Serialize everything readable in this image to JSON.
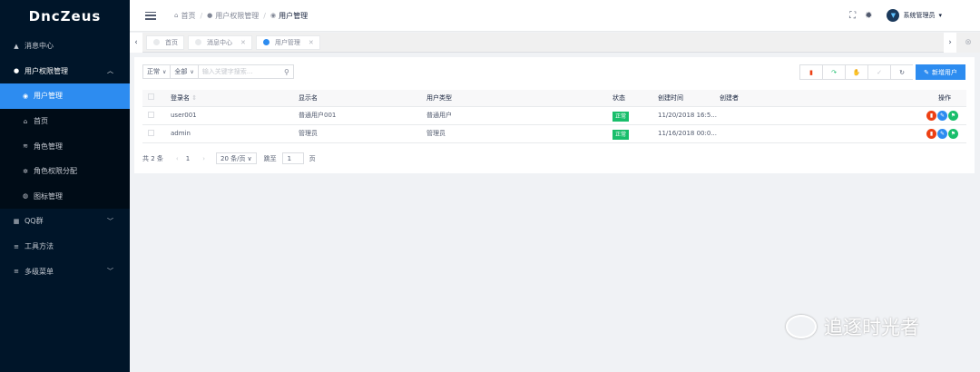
{
  "app": {
    "title": "DncZeus"
  },
  "sidebar": {
    "items": [
      {
        "label": "消息中心",
        "icon": "bell-icon"
      },
      {
        "label": "用户权限管理",
        "icon": "users-icon"
      },
      {
        "label": "用户管理",
        "icon": "user-icon"
      },
      {
        "label": "首页",
        "icon": "home-icon"
      },
      {
        "label": "角色管理",
        "icon": "role-icon"
      },
      {
        "label": "角色权限分配",
        "icon": "permission-icon"
      },
      {
        "label": "图标管理",
        "icon": "image-icon"
      },
      {
        "label": "QQ群",
        "icon": "grid-icon"
      },
      {
        "label": "工具方法",
        "icon": "menu-icon"
      },
      {
        "label": "多级菜单",
        "icon": "menu-icon"
      }
    ]
  },
  "header": {
    "breadcrumb": [
      "首页",
      "用户权限管理",
      "用户管理"
    ],
    "user_name": "系统管理员"
  },
  "tabs": [
    {
      "label": "首页"
    },
    {
      "label": "消息中心"
    },
    {
      "label": "用户管理"
    }
  ],
  "filters": {
    "status": "正常",
    "all": "全部",
    "search_placeholder": "输入关键字搜索..."
  },
  "toolbar": {
    "add_label": "新增用户"
  },
  "table": {
    "columns": [
      "登录名",
      "显示名",
      "用户类型",
      "状态",
      "创建时间",
      "创建者",
      "操作"
    ],
    "rows": [
      {
        "login": "user001",
        "display": "普通用户001",
        "type": "普通用户",
        "status": "正常",
        "created": "11/20/2018 16:5...",
        "creator": ""
      },
      {
        "login": "admin",
        "display": "管理员",
        "type": "管理员",
        "status": "正常",
        "created": "11/16/2018 00:0...",
        "creator": ""
      }
    ]
  },
  "pagination": {
    "total": "共 2 条",
    "page": "1",
    "page_size": "20 条/页",
    "jump_label": "跳至",
    "jump_value": "1",
    "page_suffix": "页"
  },
  "watermark": "追逐时光者",
  "colors": {
    "primary": "#2d8cf0",
    "success": "#19be6b",
    "danger": "#ed4014",
    "sidebar": "#001529"
  }
}
